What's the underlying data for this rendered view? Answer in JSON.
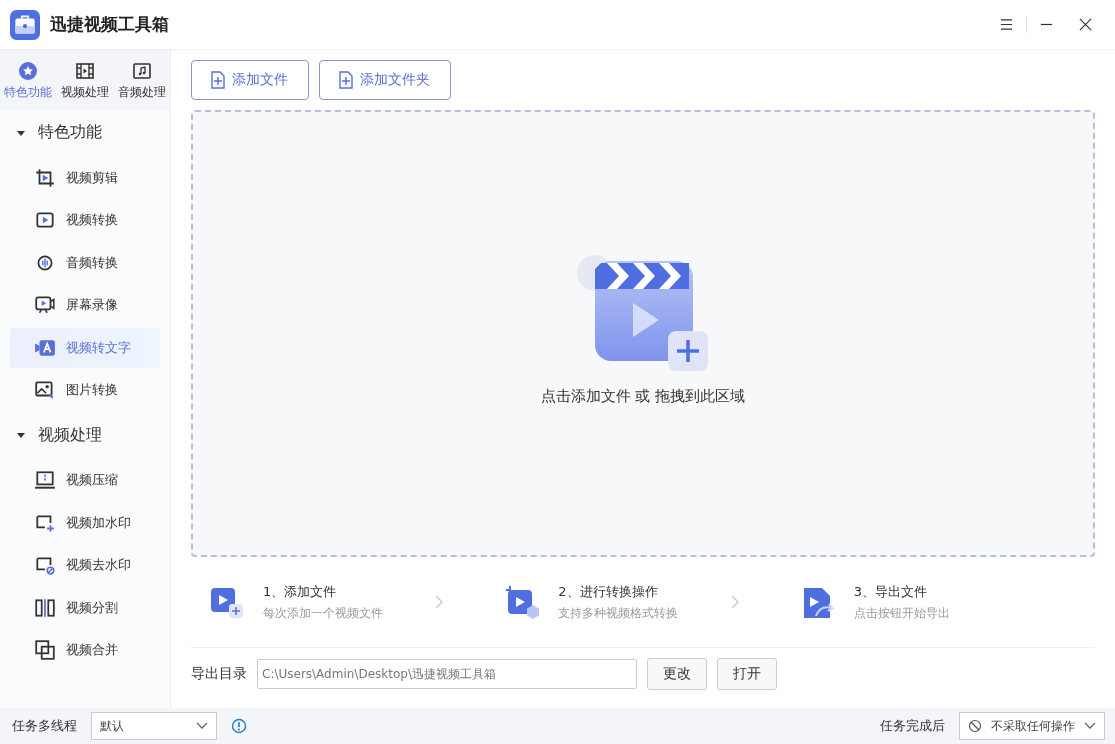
{
  "window": {
    "title": "迅捷视频工具箱"
  },
  "top_tabs": [
    {
      "label": "特色功能",
      "selected": true
    },
    {
      "label": "视频处理",
      "selected": false
    },
    {
      "label": "音频处理",
      "selected": false
    }
  ],
  "sidebar": {
    "groups": [
      {
        "label": "特色功能",
        "expanded": true,
        "children": [
          {
            "label": "视频剪辑",
            "selected": false
          },
          {
            "label": "视频转换",
            "selected": false
          },
          {
            "label": "音频转换",
            "selected": false
          },
          {
            "label": "屏幕录像",
            "selected": false
          },
          {
            "label": "视频转文字",
            "selected": true
          },
          {
            "label": "图片转换",
            "selected": false
          }
        ]
      },
      {
        "label": "视频处理",
        "expanded": true,
        "children": [
          {
            "label": "视频压缩",
            "selected": false
          },
          {
            "label": "视频加水印",
            "selected": false
          },
          {
            "label": "视频去水印",
            "selected": false
          },
          {
            "label": "视频分割",
            "selected": false
          },
          {
            "label": "视频合并",
            "selected": false
          }
        ]
      }
    ]
  },
  "toolbar": [
    "添加文件",
    "添加文件夹"
  ],
  "dropzone": {
    "hint": "点击添加文件 或 拖拽到此区域"
  },
  "steps": [
    {
      "title": "1、添加文件",
      "subtitle": "每次添加一个视频文件"
    },
    {
      "title": "2、进行转换操作",
      "subtitle": "支持多种视频格式转换"
    },
    {
      "title": "3、导出文件",
      "subtitle": "点击按钮开始导出"
    }
  ],
  "export": {
    "label": "导出目录",
    "path": "C:\\Users\\Admin\\Desktop\\迅捷视频工具箱",
    "buttons": [
      "更改",
      "打开"
    ]
  },
  "status_bar": {
    "threads_label": "任务多线程",
    "threads_value": "默认",
    "after_label": "任务完成后",
    "after_value": "不采取任何操作"
  }
}
